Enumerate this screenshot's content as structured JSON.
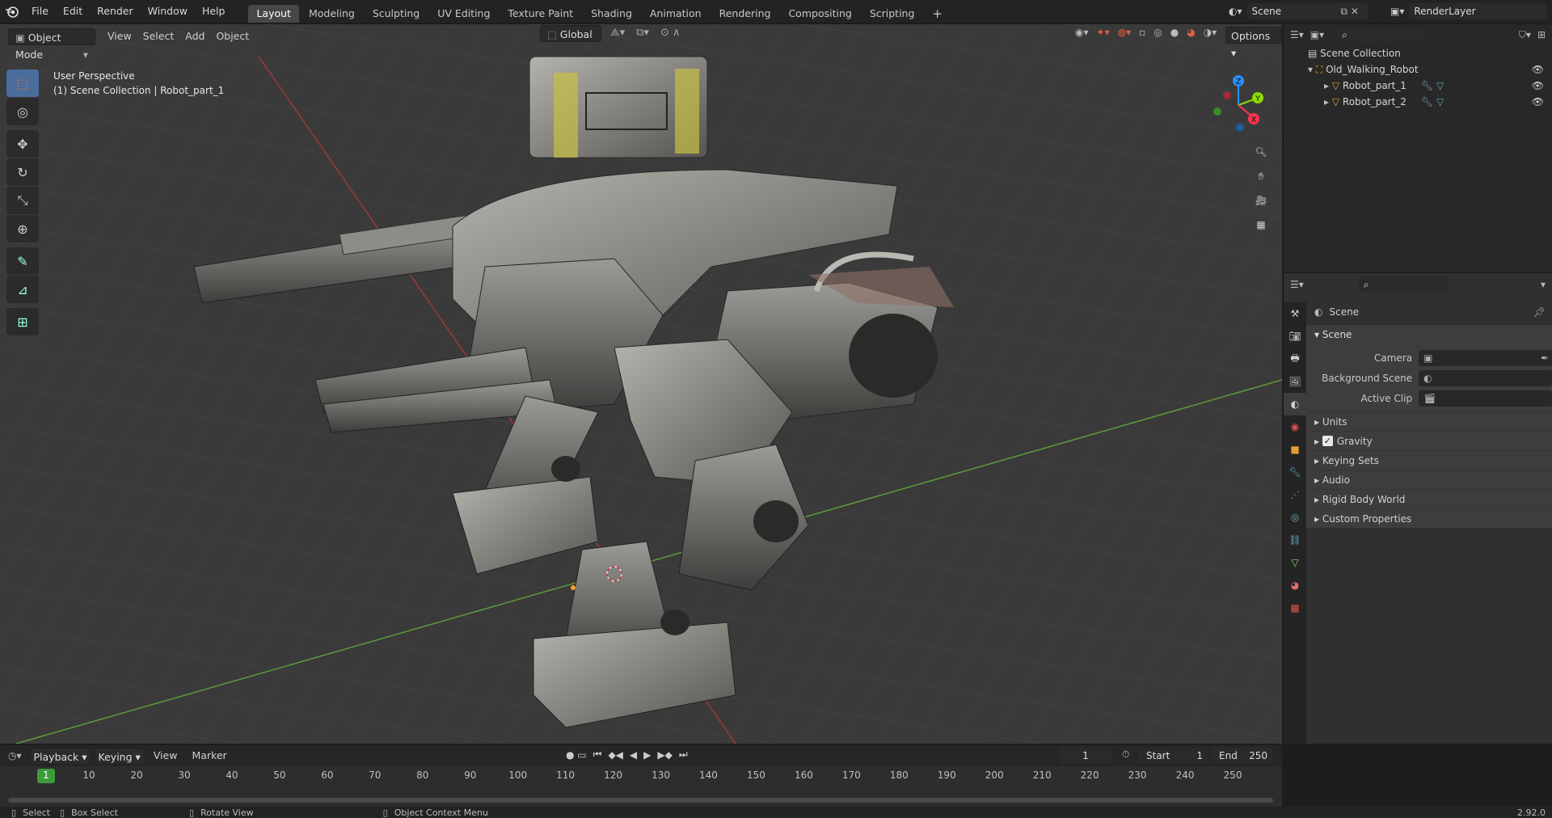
{
  "topbar": {
    "menus": [
      "File",
      "Edit",
      "Render",
      "Window",
      "Help"
    ],
    "workspaces": [
      "Layout",
      "Modeling",
      "Sculpting",
      "UV Editing",
      "Texture Paint",
      "Shading",
      "Animation",
      "Rendering",
      "Compositing",
      "Scripting"
    ],
    "active_workspace": "Layout",
    "add_tab": "+",
    "scene_name": "Scene",
    "view_layer": "RenderLayer"
  },
  "viewport": {
    "mode": "Object Mode",
    "menus": [
      "View",
      "Select",
      "Add",
      "Object"
    ],
    "transform_orientation": "Global",
    "options_label": "Options",
    "perspective_label": "User Perspective",
    "context_label": "(1) Scene Collection | Robot_part_1",
    "gizmo_axes": {
      "x": "X",
      "y": "Y",
      "z": "Z"
    }
  },
  "outliner": {
    "root": "Scene Collection",
    "collection": "Old_Walking_Robot",
    "objects": [
      "Robot_part_1",
      "Robot_part_2"
    ]
  },
  "properties": {
    "context": "Scene",
    "panel_title": "Scene",
    "fields": [
      {
        "label": "Camera"
      },
      {
        "label": "Background Scene"
      },
      {
        "label": "Active Clip"
      }
    ],
    "subpanels": [
      "Units",
      "Gravity",
      "Keying Sets",
      "Audio",
      "Rigid Body World",
      "Custom Properties"
    ],
    "gravity_checked": true
  },
  "timeline": {
    "menus": [
      "Playback",
      "Keying",
      "View",
      "Marker"
    ],
    "current_frame": "1",
    "start_label": "Start",
    "start_value": "1",
    "end_label": "End",
    "end_value": "250",
    "ticks": [
      "1",
      "10",
      "20",
      "30",
      "40",
      "50",
      "60",
      "70",
      "80",
      "90",
      "100",
      "110",
      "120",
      "130",
      "140",
      "150",
      "160",
      "170",
      "180",
      "190",
      "200",
      "210",
      "220",
      "230",
      "240",
      "250"
    ]
  },
  "statusbar": {
    "select": "Select",
    "box_select": "Box Select",
    "rotate_view": "Rotate View",
    "context_menu": "Object Context Menu",
    "version": "2.92.0"
  },
  "colors": {
    "accent": "#4b6d9c",
    "x_axis": "#ff3352",
    "y_axis": "#8bdc00",
    "z_axis": "#2890ff",
    "active_frame": "#3c9c3c"
  }
}
